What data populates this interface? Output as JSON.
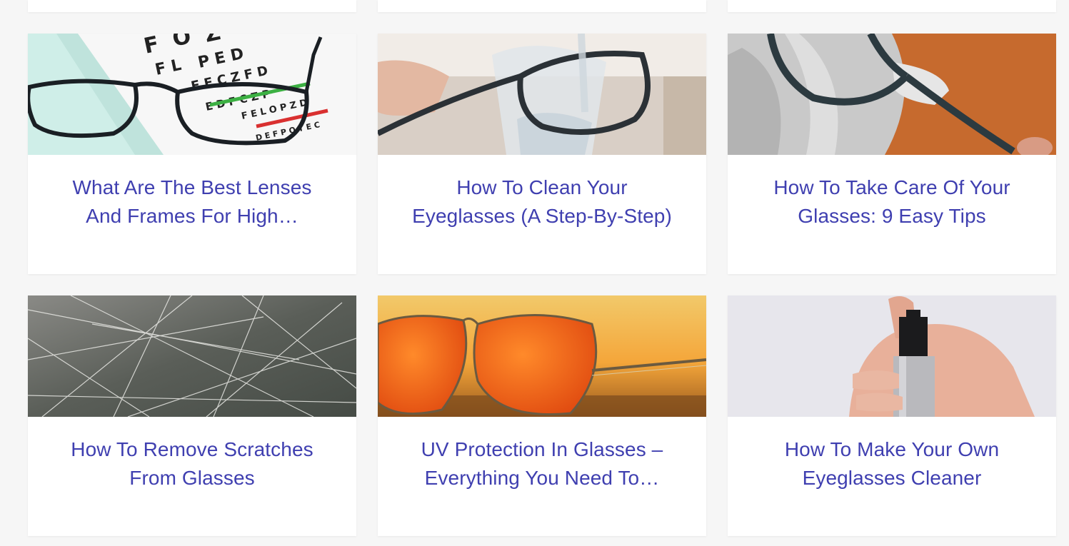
{
  "articles": [
    {
      "title": "What Are The Best Lenses And Frames For High…",
      "image_icon": "eye-chart-glasses-photo"
    },
    {
      "title": "How To Clean Your Eyeglasses (A Step-By-Step)",
      "image_icon": "glasses-rinse-photo"
    },
    {
      "title": "How To Take Care Of Your Glasses: 9 Easy Tips",
      "image_icon": "glasses-cloth-photo"
    },
    {
      "title": "How To Remove Scratches From Glasses",
      "image_icon": "scratched-lens-photo"
    },
    {
      "title": "UV Protection In Glasses – Everything You Need To…",
      "image_icon": "aviator-sunglasses-photo"
    },
    {
      "title": "How To Make Your Own Eyeglasses Cleaner",
      "image_icon": "spray-bottle-photo"
    }
  ],
  "colors": {
    "title_link": "#3f3fb0",
    "page_background": "#f6f6f6",
    "card_background": "#ffffff"
  }
}
